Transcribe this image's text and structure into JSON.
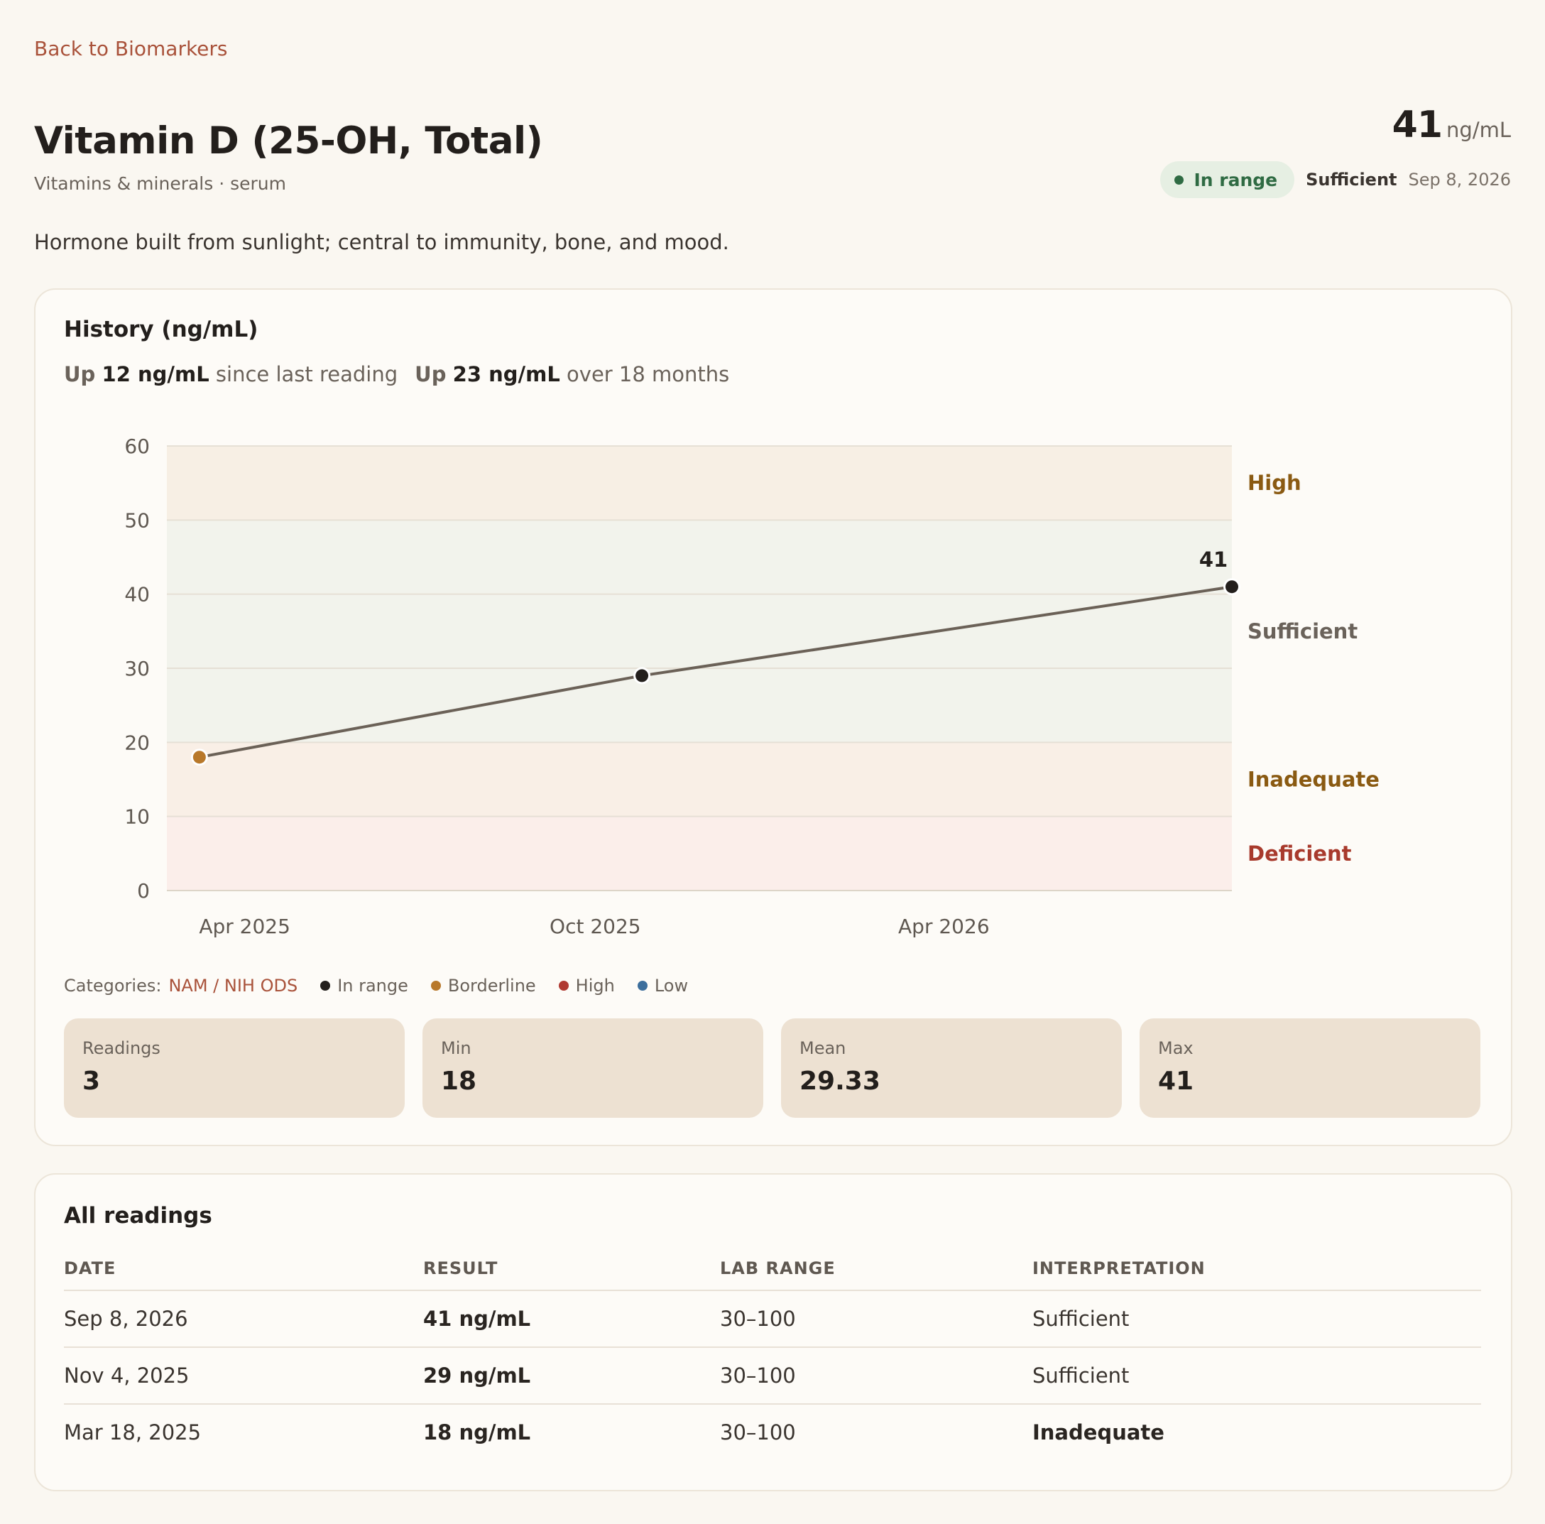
{
  "nav": {
    "back_label": "Back to Biomarkers"
  },
  "header": {
    "title": "Vitamin D (25-OH, Total)",
    "subtitle": "Vitamins & minerals · serum",
    "description": "Hormone built from sunlight; central to immunity, bone, and mood.",
    "current_value": "41",
    "current_unit": "ng/mL",
    "status_pill": "In range",
    "status_category": "Sufficient",
    "status_date": "Sep 8, 2026"
  },
  "history": {
    "title": "History (ng/mL)",
    "trend_1_prefix": "Up",
    "trend_1_value": "12 ng/mL",
    "trend_1_suffix": "since last reading",
    "trend_2_prefix": "Up",
    "trend_2_value": "23 ng/mL",
    "trend_2_suffix": "over 18 months"
  },
  "chart_data": {
    "type": "line",
    "title": "",
    "xlabel": "",
    "ylabel": "",
    "ylim": [
      0,
      60
    ],
    "y_ticks": [
      0,
      10,
      20,
      30,
      40,
      50,
      60
    ],
    "x_tick_labels": [
      "Apr 2025",
      "Oct 2025",
      "Apr 2026"
    ],
    "grid": true,
    "points": [
      {
        "date": "2025-03-18",
        "value": 18,
        "status": "Borderline"
      },
      {
        "date": "2025-11-04",
        "value": 29,
        "status": "In range"
      },
      {
        "date": "2026-09-08",
        "value": 41,
        "status": "In range"
      }
    ],
    "highlight_label": "41",
    "zones": [
      {
        "name": "High",
        "from": 50,
        "to": 60,
        "fill": "#f7efe4",
        "label_color": "#8a5a12"
      },
      {
        "name": "Sufficient",
        "from": 20,
        "to": 50,
        "fill": "#f2f3ec",
        "label_color": "#6a625a"
      },
      {
        "name": "Inadequate",
        "from": 10,
        "to": 20,
        "fill": "#f9efe6",
        "label_color": "#8a5a12"
      },
      {
        "name": "Deficient",
        "from": 0,
        "to": 10,
        "fill": "#fbeeea",
        "label_color": "#a83a2c"
      }
    ],
    "line_color": "#6b6157"
  },
  "legend": {
    "prefix": "Categories:",
    "source": "NAM / NIH ODS",
    "items": [
      {
        "label": "In range",
        "color": "#231f1c"
      },
      {
        "label": "Borderline",
        "color": "#b8782a"
      },
      {
        "label": "High",
        "color": "#b03a32"
      },
      {
        "label": "Low",
        "color": "#3c6e9c"
      }
    ]
  },
  "stats": [
    {
      "label": "Readings",
      "value": "3"
    },
    {
      "label": "Min",
      "value": "18"
    },
    {
      "label": "Mean",
      "value": "29.33"
    },
    {
      "label": "Max",
      "value": "41"
    }
  ],
  "readings": {
    "title": "All readings",
    "columns": [
      "Date",
      "Result",
      "Lab range",
      "Interpretation"
    ],
    "rows": [
      {
        "date": "Sep 8, 2026",
        "result": "41 ng/mL",
        "range": "30–100",
        "interpretation": "Sufficient"
      },
      {
        "date": "Nov 4, 2025",
        "result": "29 ng/mL",
        "range": "30–100",
        "interpretation": "Sufficient"
      },
      {
        "date": "Mar 18, 2025",
        "result": "18 ng/mL",
        "range": "30–100",
        "interpretation": "Inadequate"
      }
    ]
  }
}
